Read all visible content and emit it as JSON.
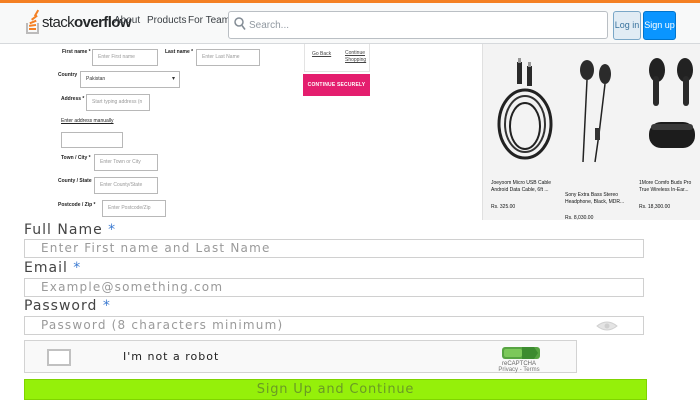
{
  "header": {
    "logo": {
      "prefix": "stack",
      "suffix": "overflow"
    },
    "nav": [
      "About",
      "Products",
      "For Teams"
    ],
    "search_placeholder": "Search...",
    "login_label": "Log in",
    "signup_label": "Sign up",
    "accent_color": "#f48024"
  },
  "address_form": {
    "first_name_label": "First name *",
    "first_name_placeholder": "Enter First name",
    "last_name_label": "Last name *",
    "last_name_placeholder": "Enter Last Name",
    "country_label": "Country",
    "country_value": "Pakistan",
    "address_label": "Address *",
    "address_placeholder": "Start typing address (n",
    "enter_manually_link": "Enter address manually",
    "town_label": "Town / City *",
    "town_placeholder": "Enter Town or City",
    "county_label": "County / State",
    "county_placeholder": "Enter County/State",
    "postcode_label": "Postcode / Zip *",
    "postcode_placeholder": "Enter Postcode/Zip"
  },
  "checkout": {
    "link_left": "Go Back",
    "link_right_line1": "Continue",
    "link_right_line2": "Shopping",
    "continue_label": "CONTINUE SECURELY",
    "continue_color": "#e41e6e"
  },
  "products": [
    {
      "title": "Joeyoom Micro USB Cable Android Data Cable, 6ft ...",
      "price": "Rs. 325.00"
    },
    {
      "title": "Sony Extra Bass Stereo Headphone, Black, MDR...",
      "price": "Rs. 8,030.00"
    },
    {
      "title": "1More Comfo Buds Pro True Wireless In-Ear...",
      "price": "Rs. 18,300.00"
    }
  ],
  "signup_form": {
    "full_name_label": "Full Name",
    "full_name_placeholder": "Enter First name and Last Name",
    "email_label": "Email",
    "email_placeholder": "Example@something.com",
    "password_label": "Password",
    "password_placeholder": "Password (8 characters minimum)",
    "required_mark": "*",
    "captcha_label": "I'm not a robot",
    "recaptcha_brand": "reCAPTCHA",
    "recaptcha_links": "Privacy - Terms",
    "submit_label": "Sign Up and Continue",
    "submit_color": "#95f00a"
  }
}
